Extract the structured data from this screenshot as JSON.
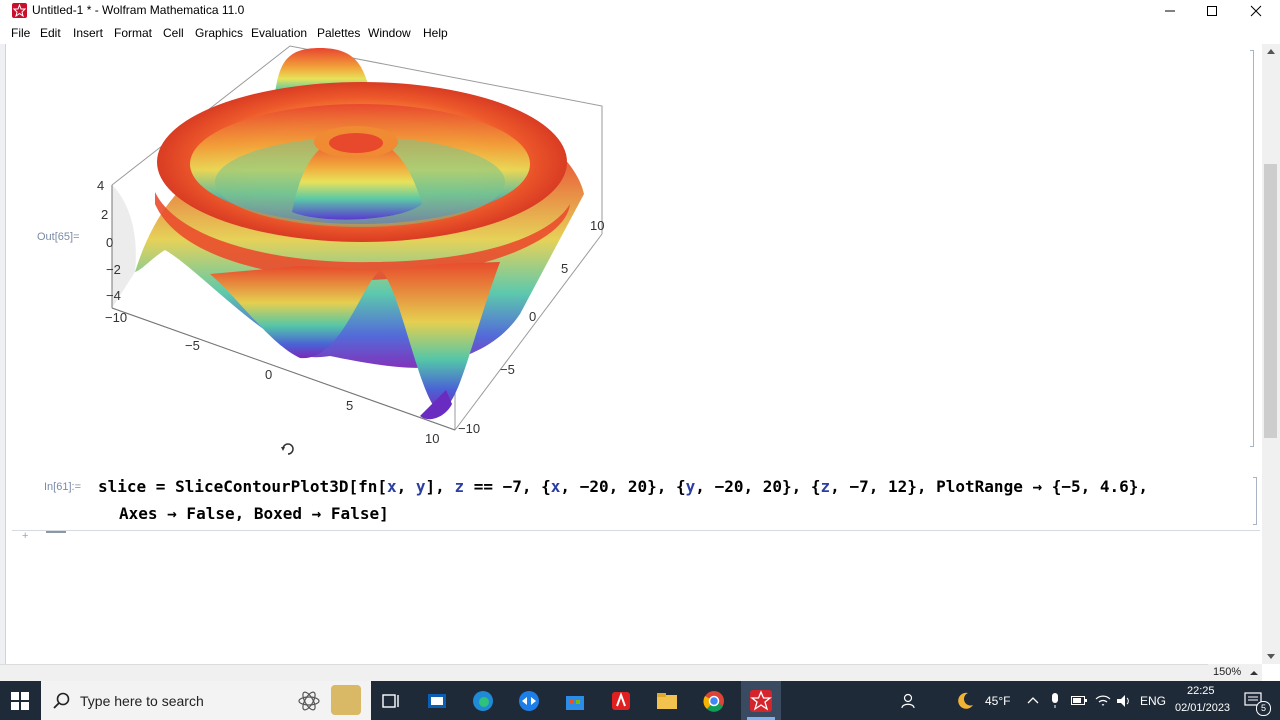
{
  "window": {
    "title": "Untitled-1 * - Wolfram Mathematica 11.0",
    "controls": [
      "minimize-icon",
      "maximize-icon",
      "close-icon"
    ]
  },
  "menu": [
    "File",
    "Edit",
    "Insert",
    "Format",
    "Cell",
    "Graphics",
    "Evaluation",
    "Palettes",
    "Window",
    "Help"
  ],
  "output_cell": {
    "label": "Out[65]=",
    "plot": {
      "type": "3d-surface",
      "z_ticks": [
        "4",
        "2",
        "0",
        "−2",
        "−4"
      ],
      "x_ticks": [
        "−10",
        "−5",
        "0",
        "5",
        "10"
      ],
      "y_ticks": [
        "10",
        "5",
        "0",
        "−5",
        "−10"
      ]
    }
  },
  "input_cell": {
    "label": "In[61]:=",
    "line1": "slice = SliceContourPlot3D[fn[x, y], z == −7, {x, −20, 20}, {y, −20, 20}, {z, −7, 12}, PlotRange → {−5, 4.6},",
    "line2": "Axes → False, Boxed → False]"
  },
  "zoom": "150%",
  "taskbar": {
    "search_placeholder": "Type here to search",
    "weather": "45°F",
    "language": "ENG",
    "time": "22:25",
    "date": "02/01/2023",
    "notification_count": "5",
    "apps": [
      "cortana-icon",
      "task-view-icon",
      "store-app-icon",
      "edge-icon",
      "teamviewer-icon",
      "microsoft-store-icon",
      "acrobat-icon",
      "file-explorer-icon",
      "chrome-icon",
      "mathematica-icon"
    ]
  },
  "colors": {
    "taskbar": "#1f2a38",
    "accent": "#c8102e",
    "label": "#7a8ba6"
  }
}
